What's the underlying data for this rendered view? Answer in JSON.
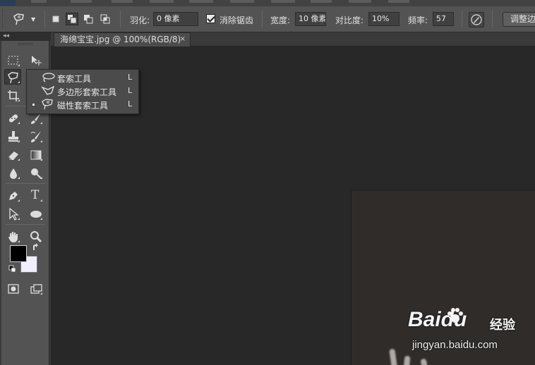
{
  "options_bar": {
    "feather_label": "羽化:",
    "feather_value": "0 像素",
    "antialias_label": "消除锯齿",
    "width_label": "宽度:",
    "width_value": "10 像素",
    "contrast_label": "对比度:",
    "contrast_value": "10%",
    "frequency_label": "频率:",
    "frequency_value": "57",
    "refine_edge_label": "调整边缘..."
  },
  "document_tab": {
    "title": "海绵宝宝.jpg @ 100%(RGB/8)",
    "close_glyph": "×"
  },
  "flyout_menu": {
    "items": [
      {
        "label": "套索工具",
        "shortcut": "L",
        "icon": "lasso-icon",
        "selected": false
      },
      {
        "label": "多边形套索工具",
        "shortcut": "L",
        "icon": "polygonal-lasso-icon",
        "selected": false
      },
      {
        "label": "磁性套索工具",
        "shortcut": "L",
        "icon": "magnetic-lasso-icon",
        "selected": true
      }
    ]
  },
  "toolbar": {
    "collapse_glyph": "◂◂",
    "tools": [
      "marquee-icon",
      "move-icon",
      "magnetic-lasso-icon",
      "magic-wand-icon",
      "crop-icon",
      "eyedropper-icon",
      "healing-brush-icon",
      "brush-icon",
      "clone-stamp-icon",
      "history-brush-icon",
      "eraser-icon",
      "gradient-icon",
      "blur-icon",
      "dodge-icon",
      "pen-icon",
      "type-icon",
      "path-selection-icon",
      "ellipse-icon",
      "hand-icon",
      "zoom-icon",
      "quick-mask-icon",
      "screen-mode-icon"
    ],
    "type_tool_glyph": "T",
    "foreground_color": "#000000",
    "background_color": "#f0eefc"
  },
  "watermark": {
    "logo_text": "Baidu",
    "cn_text": "经验",
    "url": "jingyan.baidu.com"
  }
}
